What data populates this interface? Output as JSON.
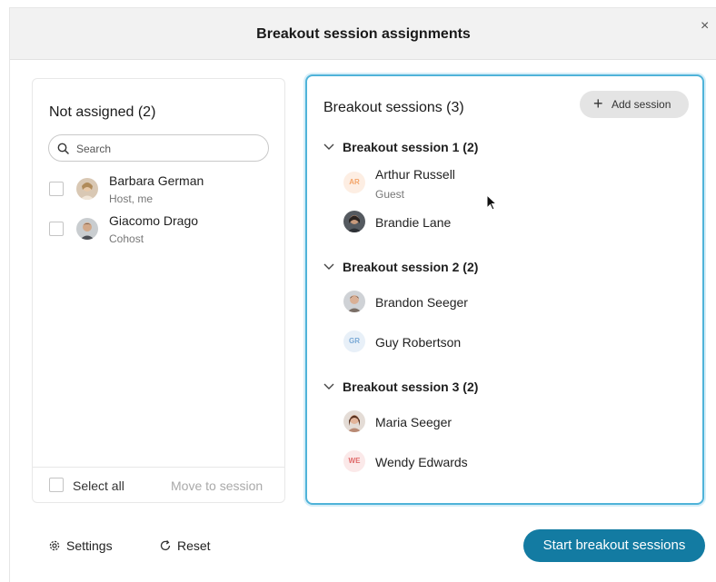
{
  "dialog": {
    "title": "Breakout session assignments",
    "close": "×"
  },
  "left_panel": {
    "title": "Not assigned (2)",
    "search_placeholder": "Search",
    "participants": [
      {
        "name": "Barbara German",
        "role": "Host, me"
      },
      {
        "name": "Giacomo Drago",
        "role": "Cohost"
      }
    ],
    "select_all": "Select all",
    "move_to_session": "Move to session"
  },
  "right_panel": {
    "title": "Breakout sessions (3)",
    "add_session": "Add session",
    "sessions": [
      {
        "name": "Breakout session 1 (2)",
        "members": [
          {
            "name": "Arthur Russell",
            "role": "Guest",
            "initials": "AR"
          },
          {
            "name": "Brandie Lane"
          }
        ]
      },
      {
        "name": "Breakout session 2 (2)",
        "members": [
          {
            "name": "Brandon Seeger"
          },
          {
            "name": "Guy Robertson",
            "initials": "GR"
          }
        ]
      },
      {
        "name": "Breakout session 3 (2)",
        "members": [
          {
            "name": "Maria Seeger"
          },
          {
            "name": "Wendy Edwards",
            "initials": "WE"
          }
        ]
      }
    ]
  },
  "footer": {
    "settings": "Settings",
    "reset": "Reset",
    "start": "Start breakout sessions"
  },
  "colors": {
    "accent": "#137ba2",
    "panel_border": "#4fb3d9",
    "initials_ar": "#f3a56a",
    "initials_gr": "#7aa9d6",
    "initials_we": "#e06b6b"
  }
}
